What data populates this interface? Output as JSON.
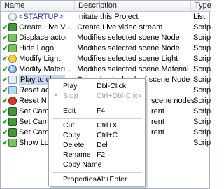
{
  "header": {
    "name": "Name",
    "description": "Description",
    "type": "Type"
  },
  "rows": [
    {
      "name": "<STARTUP>",
      "description": "Initate this Project",
      "type": "List",
      "icon": "startup-icon",
      "checked": false
    },
    {
      "name": "Create Live V...",
      "description": "Create Live video stream",
      "type": "Script",
      "icon": "camera-icon",
      "checked": true
    },
    {
      "name": "Displace actor",
      "description": "Modifies selected scene Node",
      "type": "Script",
      "icon": "script-icon",
      "checked": true
    },
    {
      "name": "Hide Logo",
      "description": "Modifies selected scene Node",
      "type": "Script",
      "icon": "script-icon",
      "checked": true
    },
    {
      "name": "Modify Light",
      "description": "Modifies selected scene Light",
      "type": "Script",
      "icon": "light-icon",
      "checked": true
    },
    {
      "name": "Modify Materi...",
      "description": "Modifies selected scene Material",
      "type": "Script",
      "icon": "material-icon",
      "checked": true
    },
    {
      "name": "Play to close",
      "description": "Controls playback of scene Node animation",
      "type": "Script",
      "icon": "play-icon",
      "checked": true
    },
    {
      "name": "Reset ac",
      "description": "",
      "type": "Script",
      "icon": "reset-icon",
      "checked": true
    },
    {
      "name": "Reset N",
      "description": "scene nodes",
      "type": "Script",
      "icon": "red-icon",
      "checked": true
    },
    {
      "name": "Set Cam",
      "description": "rent",
      "type": "Script",
      "icon": "camera-icon",
      "checked": true
    },
    {
      "name": "Set Cam",
      "description": "rent",
      "type": "Script",
      "icon": "camera-icon",
      "checked": true
    },
    {
      "name": "Set Cam",
      "description": "rent",
      "type": "Script",
      "icon": "camera-icon",
      "checked": true
    },
    {
      "name": "Show Lo",
      "description": "",
      "type": "Script",
      "icon": "script-icon",
      "checked": true
    }
  ],
  "menu": {
    "items": [
      {
        "label": "Play",
        "shortcut": "Dbl-Click",
        "disabled": false
      },
      {
        "label": "Stop",
        "shortcut": "Ctrl+Dbl-Click",
        "disabled": true
      },
      {
        "label": "Edit",
        "shortcut": "F4",
        "disabled": false
      },
      {
        "label": "Cut",
        "shortcut": "Ctrl+X",
        "disabled": false
      },
      {
        "label": "Copy",
        "shortcut": "Ctrl+C",
        "disabled": false
      },
      {
        "label": "Delete",
        "shortcut": "Del",
        "disabled": false
      },
      {
        "label": "Rename",
        "shortcut": "F2",
        "disabled": false
      },
      {
        "label": "Copy Name",
        "shortcut": "",
        "disabled": false
      },
      {
        "label": "Properties",
        "shortcut": "Alt+Enter",
        "disabled": false
      }
    ]
  },
  "colors": {
    "selection": "#c4d7ef",
    "startup_text": "#1a33b8",
    "check": "#1a9d1a"
  }
}
